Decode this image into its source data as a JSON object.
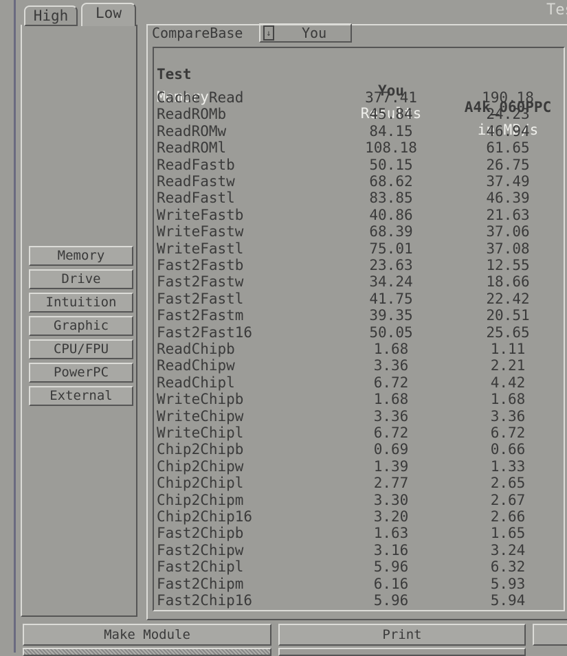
{
  "window": {
    "title_fragment": "Tes"
  },
  "tabs": [
    {
      "label": "High",
      "active": false
    },
    {
      "label": "Low",
      "active": true
    }
  ],
  "compare": {
    "label": "CompareBase",
    "value": "You",
    "cycle_icon": "cycle-gadget-icon"
  },
  "table": {
    "header": {
      "test": "Test",
      "you": "You",
      "base": "A4k_060PPC"
    },
    "section": {
      "name": "Memory",
      "you": "Results",
      "base": "in MB/s"
    },
    "rows": [
      [
        "Cache Read",
        "377.41",
        "190.18"
      ],
      [
        "ReadROMb",
        "45.84",
        "24.23"
      ],
      [
        "ReadROMw",
        "84.15",
        "46.94"
      ],
      [
        "ReadROMl",
        "108.18",
        "61.65"
      ],
      [
        "ReadFastb",
        "50.15",
        "26.75"
      ],
      [
        "ReadFastw",
        "68.62",
        "37.49"
      ],
      [
        "ReadFastl",
        "83.85",
        "46.39"
      ],
      [
        "WriteFastb",
        "40.86",
        "21.63"
      ],
      [
        "WriteFastw",
        "68.39",
        "37.06"
      ],
      [
        "WriteFastl",
        "75.01",
        "37.08"
      ],
      [
        "Fast2Fastb",
        "23.63",
        "12.55"
      ],
      [
        "Fast2Fastw",
        "34.24",
        "18.66"
      ],
      [
        "Fast2Fastl",
        "41.75",
        "22.42"
      ],
      [
        "Fast2Fastm",
        "39.35",
        "20.51"
      ],
      [
        "Fast2Fast16",
        "50.05",
        "25.65"
      ],
      [
        "ReadChipb",
        "1.68",
        "1.11"
      ],
      [
        "ReadChipw",
        "3.36",
        "2.21"
      ],
      [
        "ReadChipl",
        "6.72",
        "4.42"
      ],
      [
        "WriteChipb",
        "1.68",
        "1.68"
      ],
      [
        "WriteChipw",
        "3.36",
        "3.36"
      ],
      [
        "WriteChipl",
        "6.72",
        "6.72"
      ],
      [
        "Chip2Chipb",
        "0.69",
        "0.66"
      ],
      [
        "Chip2Chipw",
        "1.39",
        "1.33"
      ],
      [
        "Chip2Chipl",
        "2.77",
        "2.65"
      ],
      [
        "Chip2Chipm",
        "3.30",
        "2.67"
      ],
      [
        "Chip2Chip16",
        "3.20",
        "2.66"
      ],
      [
        "Fast2Chipb",
        "1.63",
        "1.65"
      ],
      [
        "Fast2Chipw",
        "3.16",
        "3.24"
      ],
      [
        "Fast2Chipl",
        "5.96",
        "6.32"
      ],
      [
        "Fast2Chipm",
        "6.16",
        "5.93"
      ],
      [
        "Fast2Chip16",
        "5.96",
        "5.94"
      ]
    ]
  },
  "categories": [
    "Memory",
    "Drive",
    "Intuition",
    "Graphic",
    "CPU/FPU",
    "PowerPC",
    "External"
  ],
  "bottom": {
    "make_module": "Make Module",
    "print": "Print"
  }
}
